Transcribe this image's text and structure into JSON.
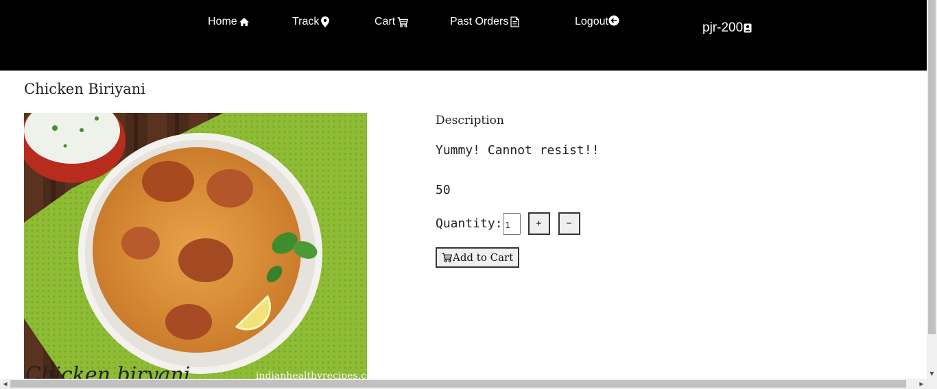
{
  "nav": {
    "items": [
      {
        "label": "Home",
        "icon": "home-icon"
      },
      {
        "label": "Track",
        "icon": "map-pin-icon"
      },
      {
        "label": "Cart",
        "icon": "cart-icon"
      },
      {
        "label": "Past Orders",
        "icon": "document-icon"
      },
      {
        "label": "Logout",
        "icon": "logout-icon"
      }
    ],
    "username": "pjr-200",
    "user_icon": "user-badge-icon"
  },
  "product": {
    "title": "Chicken Biriyani",
    "image_caption": "Chicken biryani",
    "image_watermark": "indianhealthyrecipes.com",
    "description_heading": "Description",
    "description": "Yummy! Cannot resist!!",
    "price": "50",
    "quantity_label": "Quantity:",
    "quantity_value": "1",
    "plus_label": "+",
    "minus_label": "−",
    "add_to_cart_label": "Add to Cart"
  },
  "colors": {
    "navbar_bg": "#000000",
    "nav_text": "#ffffff",
    "button_bg": "#efefef"
  }
}
